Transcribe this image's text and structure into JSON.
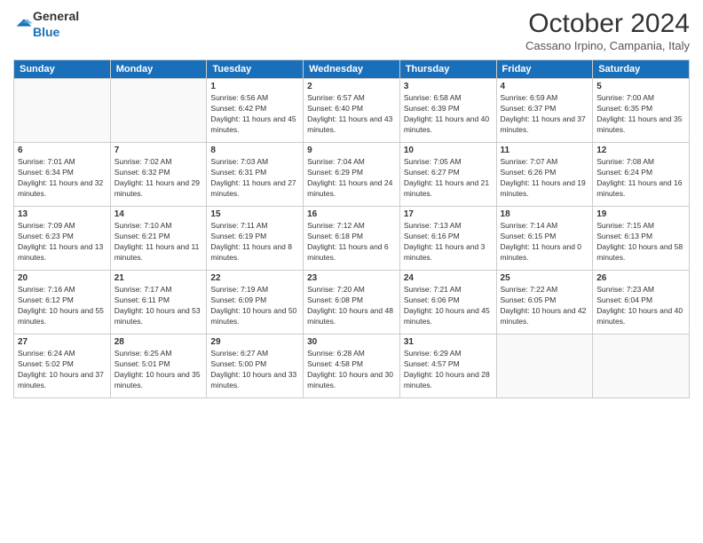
{
  "header": {
    "title": "October 2024",
    "location": "Cassano Irpino, Campania, Italy"
  },
  "columns": [
    "Sunday",
    "Monday",
    "Tuesday",
    "Wednesday",
    "Thursday",
    "Friday",
    "Saturday"
  ],
  "weeks": [
    [
      {
        "day": "",
        "info": ""
      },
      {
        "day": "",
        "info": ""
      },
      {
        "day": "1",
        "info": "Sunrise: 6:56 AM\nSunset: 6:42 PM\nDaylight: 11 hours and 45 minutes."
      },
      {
        "day": "2",
        "info": "Sunrise: 6:57 AM\nSunset: 6:40 PM\nDaylight: 11 hours and 43 minutes."
      },
      {
        "day": "3",
        "info": "Sunrise: 6:58 AM\nSunset: 6:39 PM\nDaylight: 11 hours and 40 minutes."
      },
      {
        "day": "4",
        "info": "Sunrise: 6:59 AM\nSunset: 6:37 PM\nDaylight: 11 hours and 37 minutes."
      },
      {
        "day": "5",
        "info": "Sunrise: 7:00 AM\nSunset: 6:35 PM\nDaylight: 11 hours and 35 minutes."
      }
    ],
    [
      {
        "day": "6",
        "info": "Sunrise: 7:01 AM\nSunset: 6:34 PM\nDaylight: 11 hours and 32 minutes."
      },
      {
        "day": "7",
        "info": "Sunrise: 7:02 AM\nSunset: 6:32 PM\nDaylight: 11 hours and 29 minutes."
      },
      {
        "day": "8",
        "info": "Sunrise: 7:03 AM\nSunset: 6:31 PM\nDaylight: 11 hours and 27 minutes."
      },
      {
        "day": "9",
        "info": "Sunrise: 7:04 AM\nSunset: 6:29 PM\nDaylight: 11 hours and 24 minutes."
      },
      {
        "day": "10",
        "info": "Sunrise: 7:05 AM\nSunset: 6:27 PM\nDaylight: 11 hours and 21 minutes."
      },
      {
        "day": "11",
        "info": "Sunrise: 7:07 AM\nSunset: 6:26 PM\nDaylight: 11 hours and 19 minutes."
      },
      {
        "day": "12",
        "info": "Sunrise: 7:08 AM\nSunset: 6:24 PM\nDaylight: 11 hours and 16 minutes."
      }
    ],
    [
      {
        "day": "13",
        "info": "Sunrise: 7:09 AM\nSunset: 6:23 PM\nDaylight: 11 hours and 13 minutes."
      },
      {
        "day": "14",
        "info": "Sunrise: 7:10 AM\nSunset: 6:21 PM\nDaylight: 11 hours and 11 minutes."
      },
      {
        "day": "15",
        "info": "Sunrise: 7:11 AM\nSunset: 6:19 PM\nDaylight: 11 hours and 8 minutes."
      },
      {
        "day": "16",
        "info": "Sunrise: 7:12 AM\nSunset: 6:18 PM\nDaylight: 11 hours and 6 minutes."
      },
      {
        "day": "17",
        "info": "Sunrise: 7:13 AM\nSunset: 6:16 PM\nDaylight: 11 hours and 3 minutes."
      },
      {
        "day": "18",
        "info": "Sunrise: 7:14 AM\nSunset: 6:15 PM\nDaylight: 11 hours and 0 minutes."
      },
      {
        "day": "19",
        "info": "Sunrise: 7:15 AM\nSunset: 6:13 PM\nDaylight: 10 hours and 58 minutes."
      }
    ],
    [
      {
        "day": "20",
        "info": "Sunrise: 7:16 AM\nSunset: 6:12 PM\nDaylight: 10 hours and 55 minutes."
      },
      {
        "day": "21",
        "info": "Sunrise: 7:17 AM\nSunset: 6:11 PM\nDaylight: 10 hours and 53 minutes."
      },
      {
        "day": "22",
        "info": "Sunrise: 7:19 AM\nSunset: 6:09 PM\nDaylight: 10 hours and 50 minutes."
      },
      {
        "day": "23",
        "info": "Sunrise: 7:20 AM\nSunset: 6:08 PM\nDaylight: 10 hours and 48 minutes."
      },
      {
        "day": "24",
        "info": "Sunrise: 7:21 AM\nSunset: 6:06 PM\nDaylight: 10 hours and 45 minutes."
      },
      {
        "day": "25",
        "info": "Sunrise: 7:22 AM\nSunset: 6:05 PM\nDaylight: 10 hours and 42 minutes."
      },
      {
        "day": "26",
        "info": "Sunrise: 7:23 AM\nSunset: 6:04 PM\nDaylight: 10 hours and 40 minutes."
      }
    ],
    [
      {
        "day": "27",
        "info": "Sunrise: 6:24 AM\nSunset: 5:02 PM\nDaylight: 10 hours and 37 minutes."
      },
      {
        "day": "28",
        "info": "Sunrise: 6:25 AM\nSunset: 5:01 PM\nDaylight: 10 hours and 35 minutes."
      },
      {
        "day": "29",
        "info": "Sunrise: 6:27 AM\nSunset: 5:00 PM\nDaylight: 10 hours and 33 minutes."
      },
      {
        "day": "30",
        "info": "Sunrise: 6:28 AM\nSunset: 4:58 PM\nDaylight: 10 hours and 30 minutes."
      },
      {
        "day": "31",
        "info": "Sunrise: 6:29 AM\nSunset: 4:57 PM\nDaylight: 10 hours and 28 minutes."
      },
      {
        "day": "",
        "info": ""
      },
      {
        "day": "",
        "info": ""
      }
    ]
  ]
}
